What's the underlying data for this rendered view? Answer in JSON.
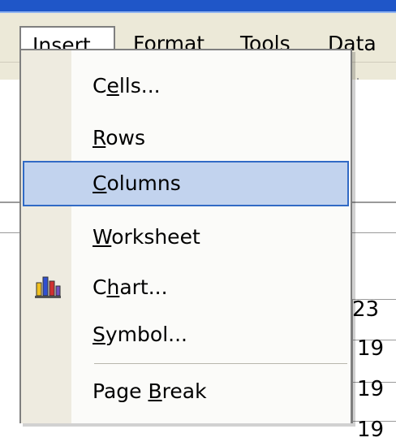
{
  "menubar": {
    "items": [
      {
        "label": "Insert",
        "mnemonic": "I"
      },
      {
        "label": "Format",
        "mnemonic": "o"
      },
      {
        "label": "Tools",
        "mnemonic": "T"
      },
      {
        "label": "Data",
        "mnemonic": "D"
      }
    ]
  },
  "dropdown": {
    "items": [
      {
        "label": "Cells...",
        "mnemonic": "e"
      },
      {
        "label": "Rows",
        "mnemonic": "R"
      },
      {
        "label": "Columns",
        "mnemonic": "C",
        "selected": true
      },
      {
        "label": "Worksheet",
        "mnemonic": "W"
      },
      {
        "label": "Chart...",
        "mnemonic": "h",
        "icon": "chart-icon"
      },
      {
        "label": "Symbol...",
        "mnemonic": "S"
      },
      {
        "label": "Page Break",
        "mnemonic": "B"
      }
    ]
  },
  "background": {
    "cells": [
      "23",
      "19",
      "19",
      "19"
    ]
  },
  "colors": {
    "menu_bg": "#ece9d8",
    "highlight_fill": "#c2d3ee",
    "highlight_border": "#316ac5",
    "titlebar": "#1f56c8"
  }
}
